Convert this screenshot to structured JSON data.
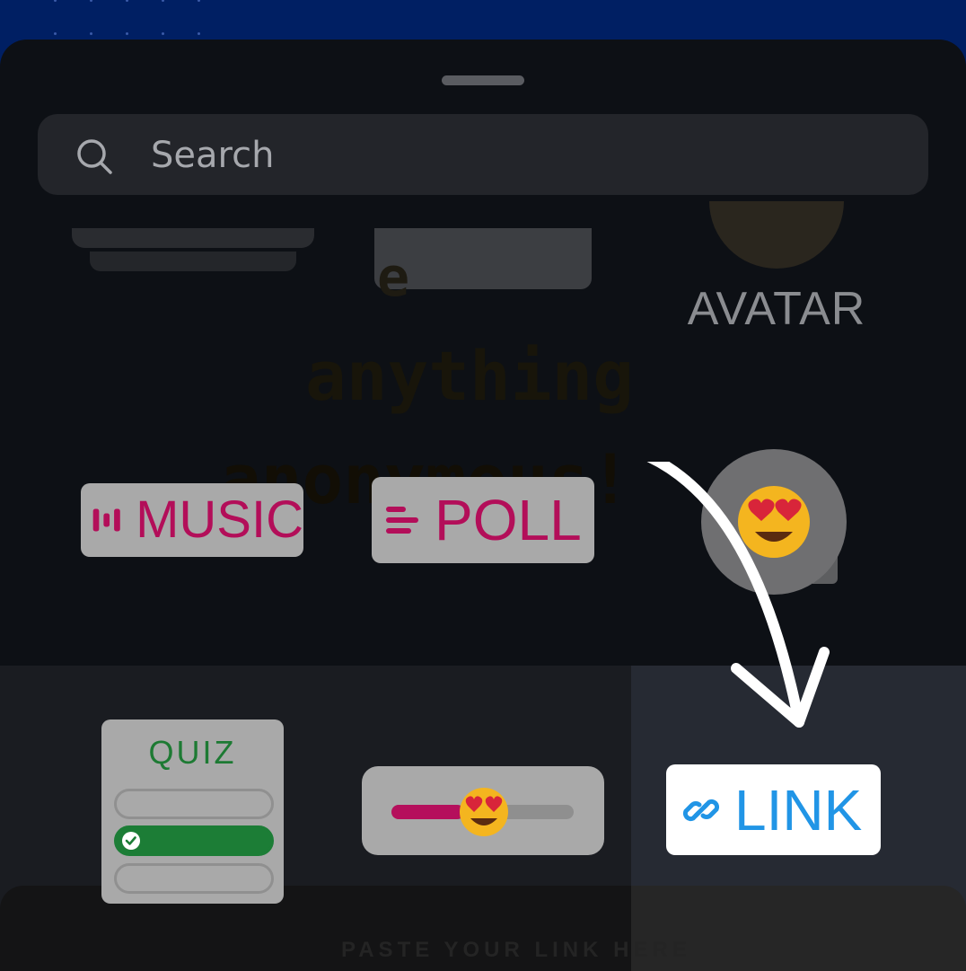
{
  "search": {
    "placeholder": "Search"
  },
  "stickers": {
    "avatar_label": "AVATAR",
    "music_label": "MUSIC",
    "poll_label": "POLL",
    "quiz_label": "QUIZ",
    "quiz_selected_option": 2,
    "slider_level_percent": 40,
    "link_label": "LINK"
  },
  "background_text": {
    "line1": "e",
    "line2": "anything",
    "line3": "anonymous!",
    "paste_hint": "PASTE YOUR LINK HERE"
  },
  "colors": {
    "music_poll_accent": "#b30e59",
    "quiz_accent": "#1d7a33",
    "link_accent": "#2195e6",
    "sheet_bg": "#0d1015",
    "top_bg": "#001f63"
  },
  "icons": {
    "search": "search-icon",
    "music": "music-bars-icon",
    "poll": "poll-lines-icon",
    "emoji": "heart-eyes-emoji-icon",
    "link": "chain-link-icon",
    "check": "check-icon",
    "arrow": "curved-arrow-icon"
  }
}
